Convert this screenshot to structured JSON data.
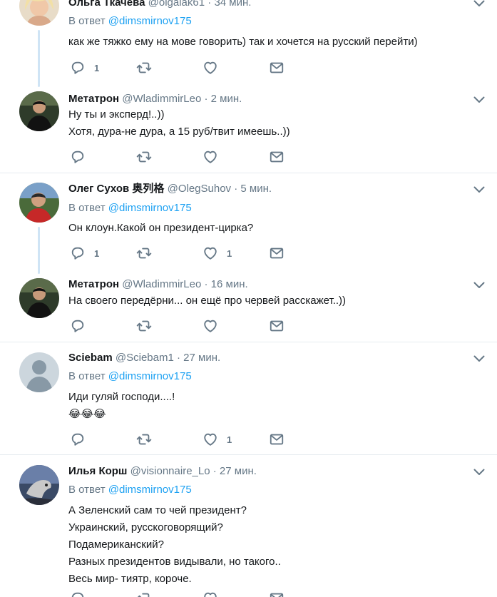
{
  "tweets": [
    {
      "name": "Ольга Ткачева",
      "handle": "@olgalak61",
      "time": "34 мин.",
      "reply_prefix": "В ответ",
      "reply_to": "@dimsmirnov175",
      "text": "как же тяжко ему на мове говорить) так и хочется на русский перейти)",
      "replies": "1",
      "retweets": "",
      "likes": ""
    },
    {
      "name": "Метатрон",
      "handle": "@WladimmirLeo",
      "time": "2 мин.",
      "text": "Ну ты и эксперд!..))\nХотя, дура-не дура, а 15 руб/твит имеешь..))",
      "replies": "",
      "retweets": "",
      "likes": ""
    },
    {
      "name": "Олег Сухов 奥列格",
      "handle": "@OlegSuhov",
      "time": "5 мин.",
      "reply_prefix": "В ответ",
      "reply_to": "@dimsmirnov175",
      "text": "Он клоун.Какой он президент-цирка?",
      "replies": "1",
      "retweets": "",
      "likes": "1"
    },
    {
      "name": "Метатрон",
      "handle": "@WladimmirLeo",
      "time": "16 мин.",
      "text": "На своего передёрни... он ещё про червей расскажет..))",
      "replies": "",
      "retweets": "",
      "likes": ""
    },
    {
      "name": "Sciebam",
      "handle": "@Sciebam1",
      "time": "27 мин.",
      "reply_prefix": "В ответ",
      "reply_to": "@dimsmirnov175",
      "text": "Иди гуляй господи....!\n😂😂😂",
      "replies": "",
      "retweets": "",
      "likes": "1"
    },
    {
      "name": "Илья Корш",
      "handle": "@visionnaire_Lo",
      "time": "27 мин.",
      "reply_prefix": "В ответ",
      "reply_to": "@dimsmirnov175",
      "text": "А Зеленский сам то чей президент?\nУкраинский, русскоговорящий?\nПодамериканский?\nРазных президентов видывали, но такого..\nВесь мир- тиятр, короче.",
      "replies": "",
      "retweets": "",
      "likes": ""
    }
  ],
  "separator": "·",
  "colors": {
    "text": "#14171a",
    "secondary": "#657786",
    "link": "#1da1f2",
    "divider": "#e6ecf0",
    "thread_line": "#cfe4f5"
  },
  "icons": {
    "reply": "reply-icon",
    "retweet": "retweet-icon",
    "like": "heart-icon",
    "message": "envelope-icon",
    "menu": "chevron-down-icon"
  }
}
